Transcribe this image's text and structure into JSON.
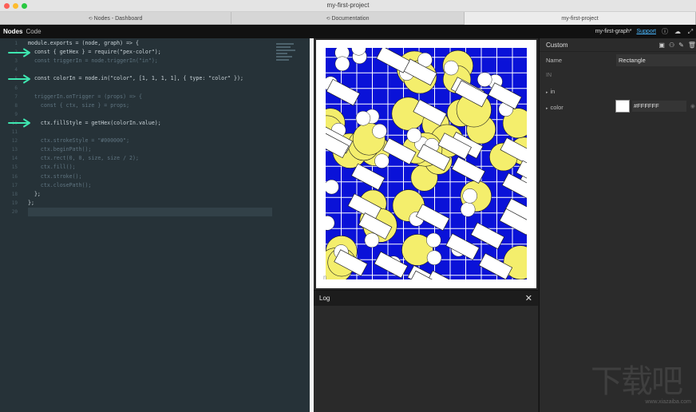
{
  "window": {
    "title": "my-first-project"
  },
  "tabs": [
    {
      "label": "Nodes - Dashboard",
      "icon": "link-icon"
    },
    {
      "label": "Documentation",
      "icon": "link-icon"
    },
    {
      "label": "my-first-project",
      "active": true
    }
  ],
  "header": {
    "nav": [
      "Nodes",
      "Code"
    ],
    "graph_name": "my-first-graph*",
    "support_label": "Support",
    "icons": [
      "info-icon",
      "cloud-icon",
      "expand-icon"
    ]
  },
  "editor": {
    "lines": [
      {
        "n": "1",
        "text": "module.exports = (node, graph) => {",
        "dim": false
      },
      {
        "n": "2",
        "text": "  const { getHex } = require(\"pex-color\");",
        "dim": false,
        "arrow": true
      },
      {
        "n": "3",
        "text": "  const triggerIn = node.triggerIn(\"in\");",
        "dim": true
      },
      {
        "n": "4",
        "text": "",
        "dim": true
      },
      {
        "n": "5",
        "text": "  const colorIn = node.in(\"color\", [1, 1, 1, 1], { type: \"color\" });",
        "dim": false,
        "arrow": true
      },
      {
        "n": "6",
        "text": "",
        "dim": true
      },
      {
        "n": "7",
        "text": "  triggerIn.onTrigger = (props) => {",
        "dim": true
      },
      {
        "n": "8",
        "text": "    const { ctx, size } = props;",
        "dim": true
      },
      {
        "n": "9",
        "text": "",
        "dim": true
      },
      {
        "n": "10",
        "text": "    ctx.fillStyle = getHex(colorIn.value);",
        "dim": false,
        "arrow": true
      },
      {
        "n": "11",
        "text": "",
        "dim": true
      },
      {
        "n": "12",
        "text": "    ctx.strokeStyle = \"#000000\";",
        "dim": true
      },
      {
        "n": "13",
        "text": "    ctx.beginPath();",
        "dim": true
      },
      {
        "n": "14",
        "text": "    ctx.rect(0, 0, size, size / 2);",
        "dim": true
      },
      {
        "n": "15",
        "text": "    ctx.fill();",
        "dim": true
      },
      {
        "n": "16",
        "text": "    ctx.stroke();",
        "dim": true
      },
      {
        "n": "17",
        "text": "    ctx.closePath();",
        "dim": true
      },
      {
        "n": "18",
        "text": "  };",
        "dim": false
      },
      {
        "n": "19",
        "text": "};",
        "dim": false
      },
      {
        "n": "20",
        "text": "",
        "dim": false,
        "active": true
      }
    ]
  },
  "preview": {
    "bg_color": "#0a12d8",
    "circle_color": "#f4ee6c",
    "rect_color": "#ffffff",
    "corner_mark": "n"
  },
  "log": {
    "title": "Log"
  },
  "inspector": {
    "title": "Custom",
    "tool_icons": [
      "image-icon",
      "person-icon",
      "brush-icon",
      "trash-icon"
    ],
    "name_label": "Name",
    "name_value": "Rectangle",
    "in_section": "IN",
    "in_port": "in",
    "color_label": "color",
    "color_value": "#FFFFFF"
  },
  "watermark": {
    "text": "下载吧",
    "url": "www.xiazaiba.com"
  }
}
